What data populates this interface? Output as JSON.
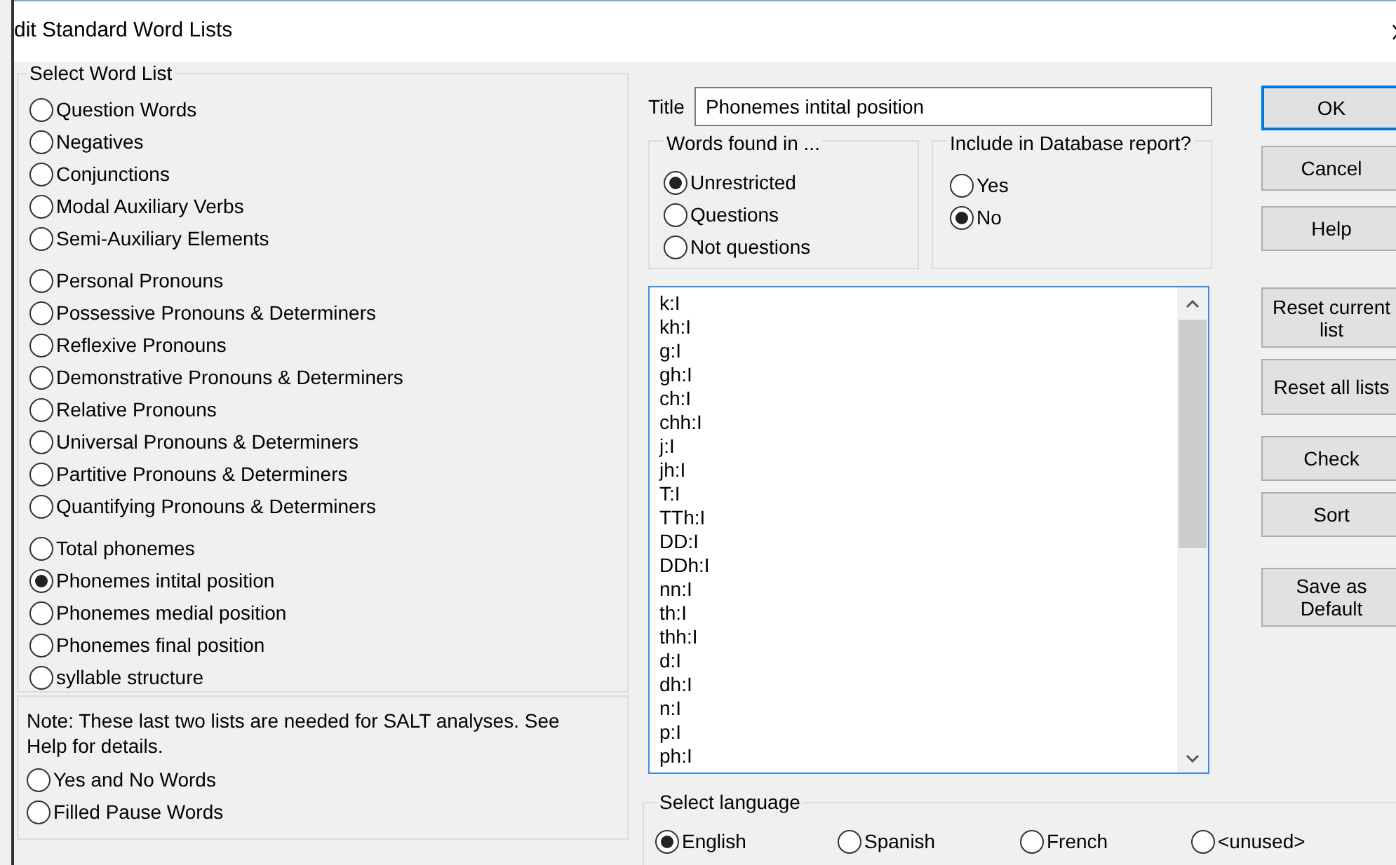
{
  "window": {
    "title": "dit Standard Word Lists"
  },
  "select_word_list": {
    "label": "Select Word List",
    "groups": [
      {
        "items": [
          {
            "label": "Question Words",
            "selected": false
          },
          {
            "label": "Negatives",
            "selected": false
          },
          {
            "label": "Conjunctions",
            "selected": false
          },
          {
            "label": "Modal Auxiliary Verbs",
            "selected": false
          },
          {
            "label": "Semi-Auxiliary Elements",
            "selected": false
          }
        ]
      },
      {
        "items": [
          {
            "label": "Personal Pronouns",
            "selected": false
          },
          {
            "label": "Possessive Pronouns & Determiners",
            "selected": false
          },
          {
            "label": "Reflexive Pronouns",
            "selected": false
          },
          {
            "label": "Demonstrative Pronouns & Determiners",
            "selected": false
          },
          {
            "label": "Relative Pronouns",
            "selected": false
          },
          {
            "label": "Universal Pronouns & Determiners",
            "selected": false
          },
          {
            "label": "Partitive Pronouns & Determiners",
            "selected": false
          },
          {
            "label": "Quantifying Pronouns & Determiners",
            "selected": false
          }
        ]
      },
      {
        "items": [
          {
            "label": "Total phonemes",
            "selected": false
          },
          {
            "label": "Phonemes intital position",
            "selected": true
          },
          {
            "label": "Phonemes medial position",
            "selected": false
          },
          {
            "label": "Phonemes final position",
            "selected": false
          },
          {
            "label": "syllable structure",
            "selected": false
          }
        ]
      }
    ],
    "note": "Note: These last two lists are needed for SALT analyses. See Help for details.",
    "extra_items": [
      {
        "label": "Yes and No Words",
        "selected": false
      },
      {
        "label": "Filled Pause Words",
        "selected": false
      }
    ]
  },
  "title_field": {
    "label": "Title",
    "value": "Phonemes intital position"
  },
  "words_found_in": {
    "label": "Words found in ...",
    "options": [
      {
        "label": "Unrestricted",
        "selected": true
      },
      {
        "label": "Questions",
        "selected": false
      },
      {
        "label": "Not questions",
        "selected": false
      }
    ]
  },
  "include_in_report": {
    "label": "Include in Database report?",
    "options": [
      {
        "label": "Yes",
        "selected": false
      },
      {
        "label": "No",
        "selected": true
      }
    ]
  },
  "word_list": [
    "k:I",
    "kh:I",
    "g:I",
    "gh:I",
    "ch:I",
    "chh:I",
    "j:I",
    "jh:I",
    "T:I",
    "TTh:I",
    "DD:I",
    "DDh:I",
    "nn:I",
    "th:I",
    "thh:I",
    "d:I",
    "dh:I",
    "n:I",
    "p:I",
    "ph:I"
  ],
  "buttons": [
    {
      "label": "OK",
      "default": true
    },
    {
      "label": "Cancel",
      "default": false
    },
    {
      "label": "Help",
      "default": false
    },
    {
      "label": "Reset current list",
      "default": false
    },
    {
      "label": "Reset all lists",
      "default": false
    },
    {
      "label": "Check",
      "default": false
    },
    {
      "label": "Sort",
      "default": false
    },
    {
      "label": "Save as Default",
      "default": false
    }
  ],
  "select_language": {
    "label": "Select language",
    "options": [
      {
        "label": "English",
        "selected": true
      },
      {
        "label": "Spanish",
        "selected": false
      },
      {
        "label": "French",
        "selected": false
      },
      {
        "label": "<unused>",
        "selected": false
      }
    ]
  }
}
